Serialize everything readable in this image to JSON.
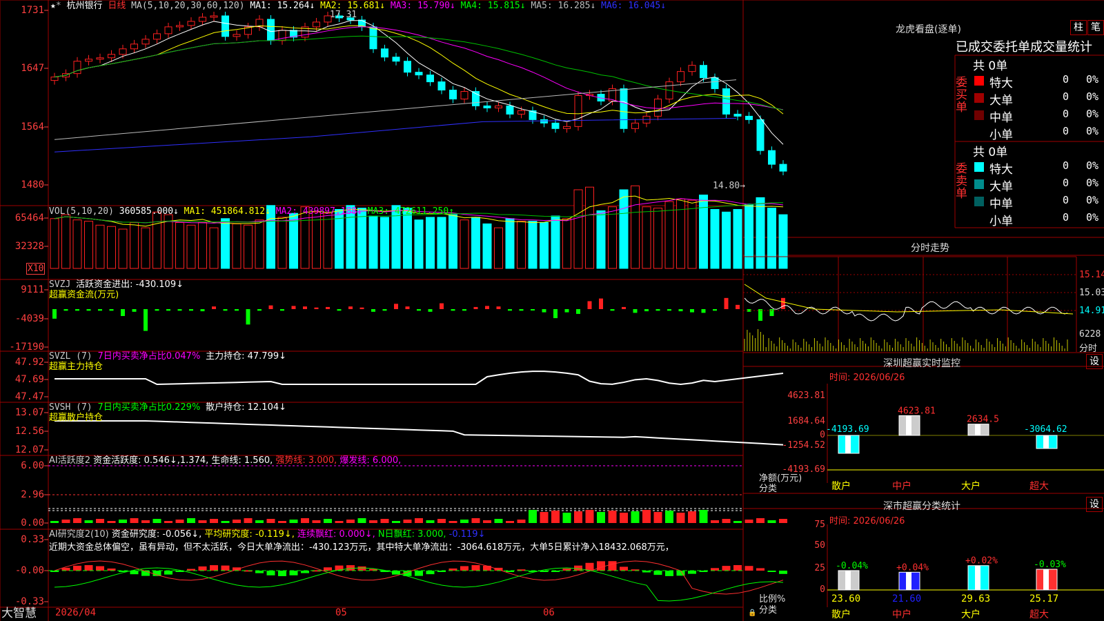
{
  "stock": {
    "name": "杭州银行",
    "period": "日线",
    "ma_title": "MA(5,10,20,30,60,120)"
  },
  "ma_values": [
    {
      "label": "MA1: 15.264↓",
      "color": "#ffffff"
    },
    {
      "label": "MA2: 15.681↓",
      "color": "#ffff00"
    },
    {
      "label": "MA3: 15.790↓",
      "color": "#ff00ff"
    },
    {
      "label": "MA4: 15.815↓",
      "color": "#00ff00"
    },
    {
      "label": "MA5: 16.285↓",
      "color": "#bbbbbb"
    },
    {
      "label": "MA6: 16.045↓",
      "color": "#3030ff"
    }
  ],
  "price_axis": [
    "1731",
    "1647",
    "1564",
    "1480"
  ],
  "high_mark": "17.31",
  "low_mark": "14.80",
  "vol_header": {
    "title": "VOL(5,10,20)",
    "value": "360585.000↓",
    "ma1": "MA1: 451864.812↓",
    "ma2": "MA2: 439897.188↓",
    "ma3": "MA3: 472611.250↑"
  },
  "vol_axis": [
    "65464",
    "32328"
  ],
  "vol_unit": "X10",
  "svzj": {
    "title": "SVZJ",
    "label": "活跃资金进出: -430.109↓",
    "subtitle": "超赢资金流(万元)",
    "axis": [
      "9111",
      "-4039",
      "-17190"
    ]
  },
  "svzl": {
    "title": "SVZL (7)",
    "ratio": "7日内买卖净占比0.047%",
    "hold": "主力持仓: 47.799↓",
    "subtitle": "超赢主力持仓",
    "axis": [
      "47.92",
      "47.69",
      "47.47"
    ]
  },
  "svsh": {
    "title": "SVSH (7)",
    "ratio": "7日内买卖净占比0.229%",
    "hold": "散户持仓: 12.104↓",
    "subtitle": "超赢散户持仓",
    "axis": [
      "13.07",
      "12.56",
      "12.07"
    ]
  },
  "ai_act": {
    "title": "AI活跃度2",
    "a": "资金活跃度: 0.546↓,1.374,",
    "b": "生命线: 1.560,",
    "c": "强势线: 3.000,",
    "d": "爆发线: 6.000,",
    "axis": [
      "6.00",
      "2.96",
      "0.00"
    ]
  },
  "ai_res": {
    "title": "AI研究度2(10)",
    "a": "资金研究度: -0.056↓,",
    "b": "平均研究度: -0.119↓,",
    "c": "连续飘红: 0.000↓,",
    "d": "N日飘红: 3.000,",
    "e": "-0.119↓",
    "axis": [
      "0.33",
      "-0.00",
      "-0.33"
    ],
    "note": "近期大资金总体偏空，虽有异动，但不太活跃，今日大单净流出：-430.123万元，其中特大单净流出：-3064.618万元，大单5日累计净入18432.068万元，"
  },
  "bottom": {
    "brand": "大智慧",
    "dates": [
      "2026/04",
      "05",
      "06"
    ]
  },
  "dragon": {
    "title": "龙虎看盘(逐单)",
    "btn1": "柱",
    "btn2": "笔",
    "header": "已成交委托单成交量统计",
    "buy": {
      "label": "委买单",
      "total": "共 0单",
      "rows": [
        {
          "name": "特大",
          "v": "0",
          "p": "0%"
        },
        {
          "name": "大单",
          "v": "0",
          "p": "0%"
        },
        {
          "name": "中单",
          "v": "0",
          "p": "0%"
        },
        {
          "name": "小单",
          "v": "0",
          "p": "0%"
        }
      ]
    },
    "sell": {
      "label": "委卖单",
      "total": "共 0单",
      "rows": [
        {
          "name": "特大",
          "v": "0",
          "p": "0%"
        },
        {
          "name": "大单",
          "v": "0",
          "p": "0%"
        },
        {
          "name": "中单",
          "v": "0",
          "p": "0%"
        },
        {
          "name": "小单",
          "v": "0",
          "p": "0%"
        }
      ]
    }
  },
  "intraday": {
    "title": "分时走势",
    "axis": [
      "15.14",
      "15.03",
      "14.91"
    ],
    "vol": "6228",
    "unit": "分时"
  },
  "monitor": {
    "title": "深圳超赢实时监控",
    "btn": "设",
    "date": "时间: 2026/06/26",
    "axis": [
      "4623.81",
      "1684.64",
      "0",
      "-1254.52",
      "-4193.69"
    ],
    "ylabel": "净额(万元)",
    "xlabel": "分类",
    "cats": [
      "散户",
      "中户",
      "大户",
      "超大"
    ],
    "values": [
      -4193.69,
      4623.81,
      2634.5,
      -3064.62
    ],
    "value_labels": [
      "-4193.69",
      "4623.81",
      "2634.5",
      "-3064.62"
    ]
  },
  "classify": {
    "title": "深市超赢分类统计",
    "btn": "设",
    "date": "时间: 2026/06/26",
    "axis": [
      "75",
      "50",
      "25",
      "0"
    ],
    "ylabel": "比例%",
    "xlabel": "分类",
    "cats": [
      "散户",
      "中户",
      "大户",
      "超大"
    ],
    "values": [
      23.6,
      21.6,
      29.63,
      25.17
    ],
    "changes": [
      "-0.04%",
      "+0.04%",
      "+0.02%",
      "-0.03%"
    ],
    "value_labels": [
      "23.60",
      "21.60",
      "29.63",
      "25.17"
    ]
  },
  "chart_data": [
    {
      "type": "candlestick",
      "title": "杭州银行 日线",
      "ylim": [
        14.8,
        17.31
      ],
      "close": [
        16.37,
        16.42,
        16.6,
        16.63,
        16.65,
        16.7,
        16.78,
        16.85,
        16.92,
        17.0,
        17.1,
        17.12,
        17.18,
        17.24,
        17.26,
        16.96,
        16.99,
        17.1,
        17.21,
        16.9,
        17.05,
        16.95,
        17.1,
        17.17,
        17.26,
        17.23,
        17.2,
        17.1,
        16.78,
        16.66,
        16.6,
        16.44,
        16.4,
        16.3,
        16.18,
        16.05,
        16.16,
        15.95,
        15.92,
        15.95,
        15.83,
        15.88,
        15.75,
        15.7,
        15.62,
        15.65,
        16.1,
        16.12,
        16.02,
        16.2,
        15.62,
        15.7,
        15.8,
        16.05,
        16.3,
        16.45,
        16.54,
        16.36,
        16.2,
        15.83,
        15.8,
        15.75,
        15.3,
        15.1,
        15.0
      ],
      "volume_k": [
        38,
        41,
        37,
        36,
        33,
        32,
        30,
        35,
        31,
        43,
        41,
        35,
        33,
        35,
        31,
        38,
        34,
        33,
        37,
        48,
        39,
        42,
        47,
        43,
        42,
        45,
        48,
        46,
        40,
        39,
        48,
        46,
        37,
        39,
        39,
        41,
        37,
        39,
        34,
        31,
        38,
        36,
        36,
        35,
        40,
        38,
        60,
        62,
        44,
        47,
        60,
        63,
        47,
        46,
        51,
        53,
        52,
        56,
        45,
        43,
        45,
        49,
        54,
        46,
        41
      ],
      "svzj": [
        -1800,
        -300,
        -300,
        -300,
        -300,
        -300,
        -1300,
        -500,
        -4100,
        -300,
        -300,
        -300,
        -300,
        -400,
        500,
        -300,
        -300,
        -2900,
        -300,
        700,
        -300,
        600,
        500,
        300,
        400,
        -300,
        500,
        300,
        -500,
        -300,
        1000,
        500,
        -300,
        -500,
        1100,
        -300,
        -300,
        400,
        600,
        500,
        -300,
        -300,
        -200,
        -600,
        -1700,
        -600,
        -900,
        1500,
        2000,
        -300,
        400,
        -700,
        -400,
        -300,
        -300,
        -400,
        -600,
        -700,
        -300,
        2100,
        800,
        -500,
        -2200,
        -1300,
        2100,
        1500,
        1000,
        500,
        -300
      ]
    },
    {
      "type": "bar",
      "title": "深圳超赢实时监控",
      "categories": [
        "散户",
        "中户",
        "大户",
        "超大"
      ],
      "values": [
        -4193.69,
        4623.81,
        2634.5,
        -3064.62
      ]
    },
    {
      "type": "bar",
      "title": "深市超赢分类统计",
      "categories": [
        "散户",
        "中户",
        "大户",
        "超大"
      ],
      "values": [
        23.6,
        21.6,
        29.63,
        25.17
      ]
    }
  ]
}
